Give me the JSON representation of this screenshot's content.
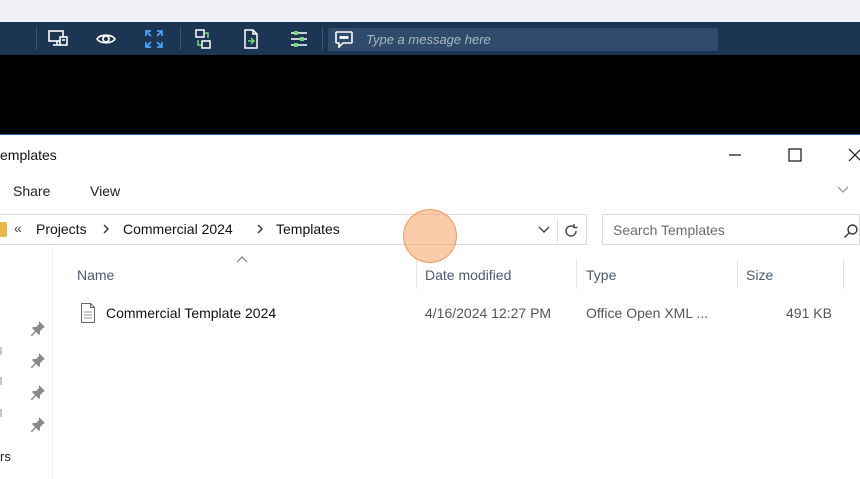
{
  "remote_toolbar": {
    "message_placeholder": "Type a message here",
    "icons": [
      "remote-screen-icon",
      "view-icon",
      "fullscreen-icon",
      "file-transfer-icon",
      "document-icon",
      "settings-icon",
      "chat-icon"
    ],
    "bg_color": "#1c3552"
  },
  "window": {
    "title": "emplates",
    "controls": [
      "minimize-icon",
      "maximize-icon",
      "close-icon"
    ]
  },
  "ribbon": {
    "tabs": [
      "Share",
      "View"
    ]
  },
  "address": {
    "overflow": "«",
    "crumbs": [
      "Projects",
      "Commercial 2024",
      "Templates"
    ],
    "search_placeholder": "Search Templates"
  },
  "nav": {
    "fragment_label": "rs"
  },
  "columns": {
    "name": "Name",
    "date": "Date modified",
    "type": "Type",
    "size": "Size"
  },
  "files": [
    {
      "name": "Commercial Template 2024",
      "date": "4/16/2024 12:27 PM",
      "type": "Office Open XML ...",
      "size": "491 KB"
    }
  ],
  "accent_color": "#2b6cb0"
}
